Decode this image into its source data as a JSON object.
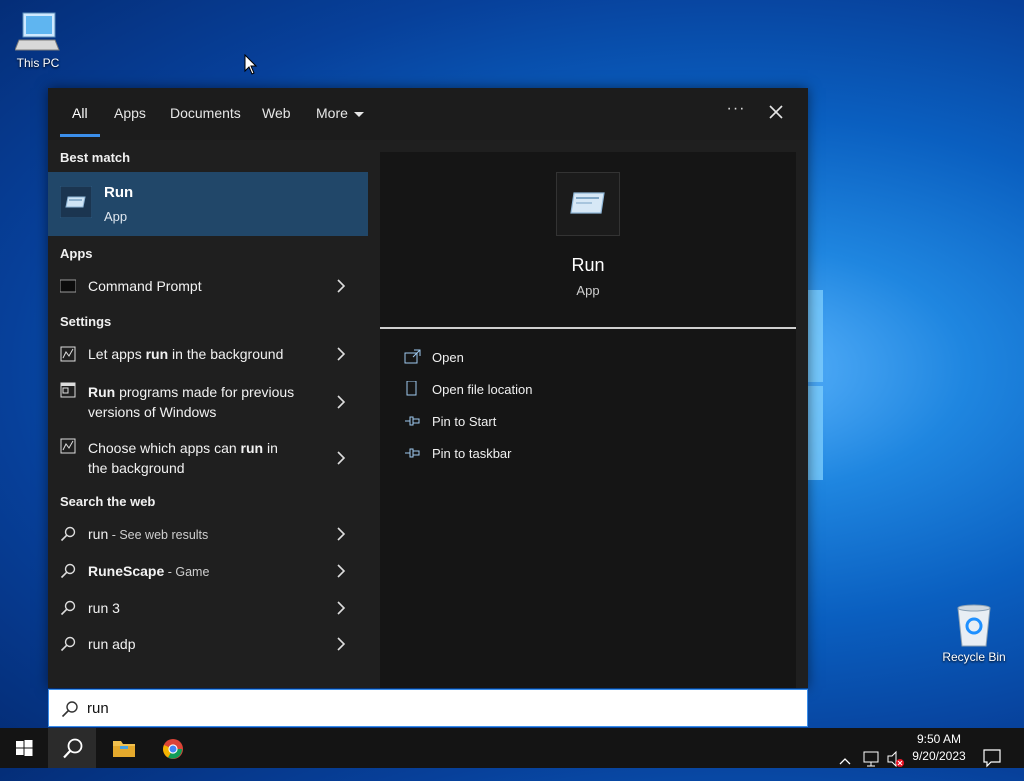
{
  "desktop": {
    "this_pc_label": "This PC",
    "recycle_bin_label": "Recycle Bin"
  },
  "tabs": [
    "All",
    "Apps",
    "Documents",
    "Web",
    "More"
  ],
  "more_options_label": "···",
  "best_match": {
    "header": "Best match",
    "title": "Run",
    "subtitle": "App"
  },
  "apps_section": {
    "header": "Apps",
    "items": [
      "Command Prompt"
    ]
  },
  "settings_section": {
    "header": "Settings",
    "items": [
      {
        "pre": "Let apps ",
        "bold": "run",
        "post": " in the background",
        "line2": ""
      },
      {
        "pre": "",
        "bold": "Run",
        "post": " programs made for previous",
        "line2": "versions of Windows"
      },
      {
        "pre": "Choose which apps can ",
        "bold": "run",
        "post": " in",
        "line2": "the background"
      }
    ]
  },
  "web_section": {
    "header": "Search the web",
    "items": [
      {
        "query": "run",
        "suffix": " - See web results"
      },
      {
        "query": "RuneScape",
        "suffix": " - Game"
      },
      {
        "query": "run 3",
        "suffix": ""
      },
      {
        "query": "run adp",
        "suffix": ""
      }
    ]
  },
  "preview": {
    "title": "Run",
    "type": "App",
    "actions": [
      "Open",
      "Open file location",
      "Pin to Start",
      "Pin to taskbar"
    ]
  },
  "search": {
    "value": "run"
  },
  "clock": {
    "time": "9:50 AM",
    "date": "9/20/2023"
  },
  "colors": {
    "accent": "#3b8eea",
    "selected_row": "#214769",
    "panel_bg": "#1f1f1f"
  }
}
